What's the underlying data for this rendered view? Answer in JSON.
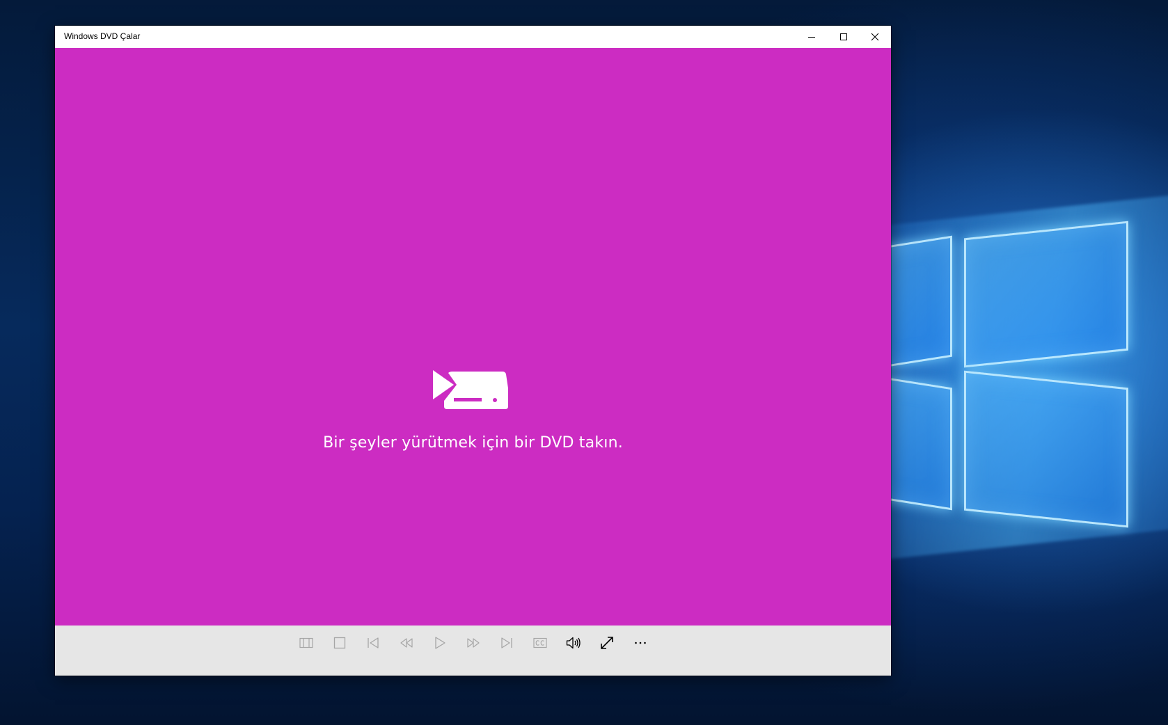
{
  "window": {
    "title": "Windows DVD Çalar"
  },
  "main": {
    "message": "Bir şeyler yürütmek için bir DVD takın."
  },
  "colors": {
    "accent": "#cc2cc2",
    "controlbar_bg": "#e6e6e6",
    "disabled_icon": "#a6a6a6",
    "enabled_icon": "#000000"
  },
  "controls": [
    {
      "name": "menu-icon",
      "enabled": false
    },
    {
      "name": "stop-icon",
      "enabled": false
    },
    {
      "name": "previous-chapter-icon",
      "enabled": false
    },
    {
      "name": "rewind-icon",
      "enabled": false
    },
    {
      "name": "play-icon",
      "enabled": false
    },
    {
      "name": "fast-forward-icon",
      "enabled": false
    },
    {
      "name": "next-chapter-icon",
      "enabled": false
    },
    {
      "name": "closed-captions-icon",
      "enabled": false
    },
    {
      "name": "volume-icon",
      "enabled": true
    },
    {
      "name": "full-screen-icon",
      "enabled": true
    },
    {
      "name": "more-options-icon",
      "enabled": true
    }
  ]
}
